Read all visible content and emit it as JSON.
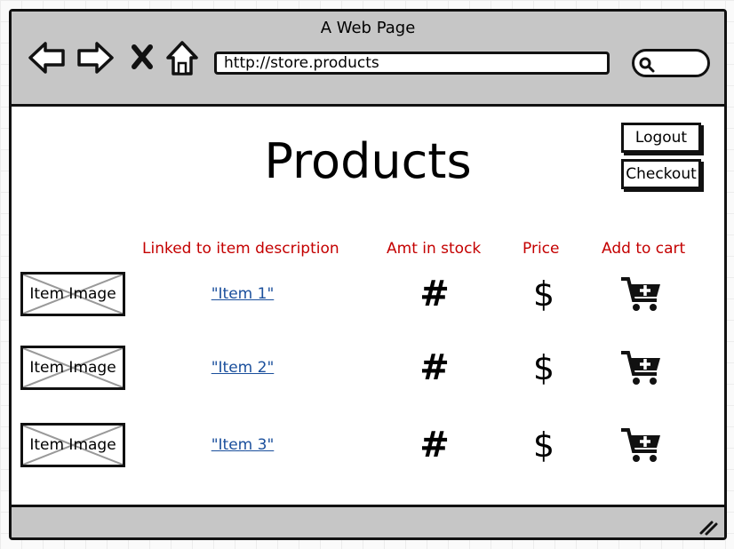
{
  "window": {
    "title": "A Web Page",
    "url": "http://store.products"
  },
  "page": {
    "heading": "Products",
    "logout_label": "Logout",
    "checkout_label": "Checkout"
  },
  "columns": {
    "description": "Linked to item description",
    "stock": "Amt in stock",
    "price": "Price",
    "cart": "Add to cart"
  },
  "items": [
    {
      "image_label": "Item Image",
      "name": "\"Item 1\"",
      "stock": "#",
      "price": "$"
    },
    {
      "image_label": "Item Image",
      "name": "\"Item 2\"",
      "stock": "#",
      "price": "$"
    },
    {
      "image_label": "Item Image",
      "name": "\"Item 3\"",
      "stock": "#",
      "price": "$"
    }
  ],
  "colors": {
    "header_text": "#c40000",
    "link": "#1a4f9c",
    "chrome": "#c6c6c6"
  },
  "icons": [
    "back-arrow-icon",
    "forward-arrow-icon",
    "stop-icon",
    "home-icon",
    "search-icon",
    "cart-add-icon",
    "resize-handle-icon"
  ]
}
